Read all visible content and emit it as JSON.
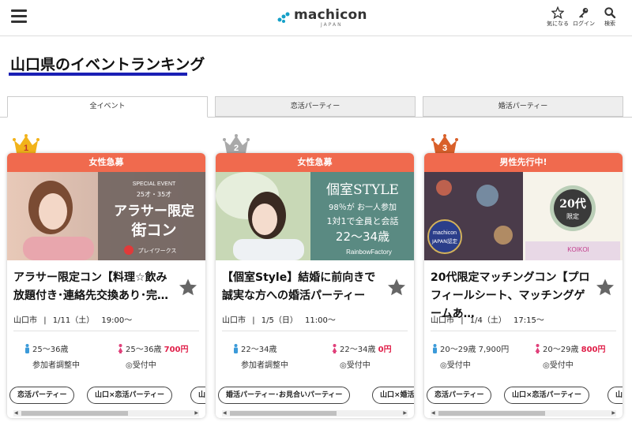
{
  "header": {
    "logo_text": "machicon",
    "logo_sub": "JAPAN",
    "icons": [
      {
        "name": "star-icon",
        "label": "気になる"
      },
      {
        "name": "key-icon",
        "label": "ログイン"
      },
      {
        "name": "search-icon",
        "label": "検索"
      }
    ]
  },
  "page_title": "山口県のイベントランキング",
  "tabs": [
    "全イベント",
    "恋活パーティー",
    "婚活パーティー"
  ],
  "colors": {
    "badge": "#f06a4e",
    "underline": "#1a1fb5",
    "price": "#e0204a",
    "male": "#3b9ad9",
    "female": "#e0407a"
  },
  "cards": [
    {
      "rank": "1",
      "badge": "女性急募",
      "image": {
        "line1": "SPECIAL EVENT",
        "line2": "25才・35才",
        "line3": "アラサー限定",
        "line4": "街コン",
        "line5": "プレイワークス"
      },
      "title": "アラサー限定コン【料理☆飲み放題付き･連絡先交換あり･完…",
      "location": "山口市",
      "date": "1/11（土）",
      "time": "19:00〜",
      "male": {
        "age": "25〜36歳",
        "price": "",
        "status": "参加者調整中"
      },
      "female": {
        "age": "25〜36歳",
        "price": "700円",
        "status": "受付中"
      },
      "tags": [
        "恋活パーティー",
        "山口×恋活パーティー",
        "山"
      ]
    },
    {
      "rank": "2",
      "badge": "女性急募",
      "image": {
        "line1": "個室STYLE",
        "line2": "98％が お一人参加",
        "line3": "1対1で全員と会話",
        "line4": "22〜34歳",
        "line5": "RainbowFactory"
      },
      "title": "【個室Style】結婚に前向きで誠実な方への婚活パーティー",
      "location": "山口市",
      "date": "1/5（日）",
      "time": "11:00〜",
      "male": {
        "age": "22〜34歳",
        "price": "",
        "status": "参加者調整中"
      },
      "female": {
        "age": "22〜34歳",
        "price": "0円",
        "status": "受付中"
      },
      "tags": [
        "婚活パーティー･お見合いパーティー",
        "山口×婚活"
      ]
    },
    {
      "rank": "3",
      "badge": "男性先行中!",
      "image": {
        "line1": "machicon",
        "line2": "JAPAN認定",
        "line3": "20代",
        "line4": "限定",
        "line5": "KOIKOI"
      },
      "title": "20代限定マッチングコン【プロフィールシート、マッチングゲームあ…",
      "location": "山口市",
      "date": "1/4（土）",
      "time": "17:15〜",
      "male": {
        "age": "20〜29歳",
        "price": "7,900円",
        "status": "受付中"
      },
      "female": {
        "age": "20〜29歳",
        "price": "800円",
        "status": "受付中"
      },
      "tags": [
        "恋活パーティー",
        "山口×恋活パーティー",
        "山"
      ]
    }
  ]
}
